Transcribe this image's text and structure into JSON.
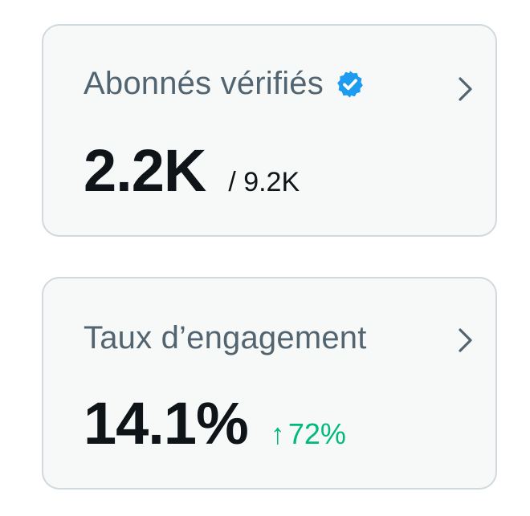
{
  "colors": {
    "card_background": "#f7f9f9",
    "card_border": "#cfd9de",
    "title_text": "#536471",
    "value_text": "#0f1419",
    "verified_blue": "#1d9bf0",
    "positive_green": "#00ba7c",
    "chevron": "#536471"
  },
  "verified_followers": {
    "label": "Abonnés vérifiés",
    "badge_icon": "verified-badge-icon",
    "value": "2.2K",
    "total": "/ 9.2K",
    "chevron_icon": "chevron-right-icon"
  },
  "engagement_rate": {
    "label": "Taux d’engagement",
    "value": "14.1%",
    "change_arrow": "↑",
    "change_value": "72%",
    "chevron_icon": "chevron-right-icon"
  }
}
